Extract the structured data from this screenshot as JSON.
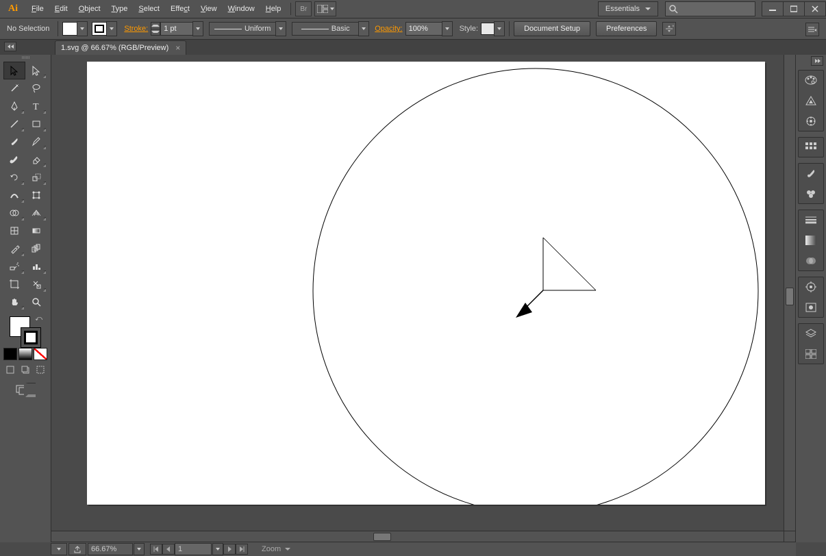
{
  "menus": [
    "File",
    "Edit",
    "Object",
    "Type",
    "Select",
    "Effect",
    "View",
    "Window",
    "Help"
  ],
  "workspace": "Essentials",
  "ctrl": {
    "selection": "No Selection",
    "stroke_label": "Stroke:",
    "stroke_weight": "1 pt",
    "profile": "Uniform",
    "brush": "Basic",
    "opacity_label": "Opacity:",
    "opacity": "100%",
    "style_label": "Style:",
    "doc_setup": "Document Setup",
    "prefs": "Preferences"
  },
  "tab": {
    "title": "1.svg @ 66.67% (RGB/Preview)"
  },
  "status": {
    "zoom": "66.67%",
    "page": "1",
    "tool": "Zoom"
  },
  "tools_left": [
    [
      "selection",
      "direct-selection"
    ],
    [
      "magic-wand",
      "lasso"
    ],
    [
      "pen",
      "type"
    ],
    [
      "line-segment",
      "rectangle"
    ],
    [
      "paintbrush",
      "pencil"
    ],
    [
      "blob-brush",
      "eraser"
    ],
    [
      "rotate",
      "scale"
    ],
    [
      "width",
      "free-transform"
    ],
    [
      "shape-builder",
      "perspective-grid"
    ],
    [
      "mesh",
      "gradient"
    ],
    [
      "eyedropper",
      "blend"
    ],
    [
      "symbol-sprayer",
      "column-graph"
    ],
    [
      "artboard",
      "slice"
    ],
    [
      "hand",
      "zoom"
    ]
  ],
  "panels_right": [
    [
      "color",
      "color-guide",
      "kuler"
    ],
    [
      "swatches"
    ],
    [
      "brushes",
      "symbols"
    ],
    [
      "stroke-panel",
      "gradient-panel",
      "transparency"
    ],
    [
      "appearance",
      "graphic-styles"
    ],
    [
      "layers",
      "artboards"
    ]
  ]
}
